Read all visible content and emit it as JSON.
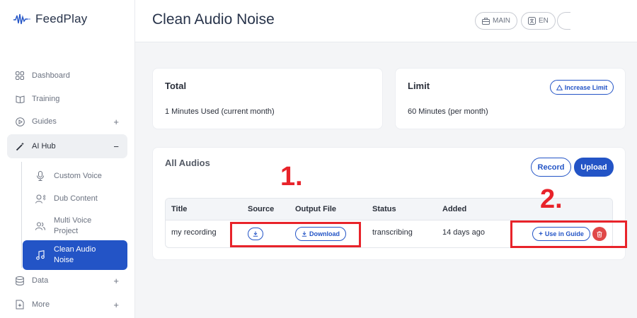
{
  "app": {
    "name": "FeedPlay"
  },
  "sidebar": {
    "items": [
      {
        "label": "Dashboard",
        "icon": "grid-icon"
      },
      {
        "label": "Training",
        "icon": "book-icon"
      },
      {
        "label": "Guides",
        "icon": "play-circle-icon",
        "toggle": "+"
      },
      {
        "label": "AI Hub",
        "icon": "magic-wand-icon",
        "toggle": "−"
      },
      {
        "label": "Data",
        "icon": "database-icon",
        "toggle": "+"
      },
      {
        "label": "More",
        "icon": "sparkle-doc-icon",
        "toggle": "+"
      }
    ],
    "sub_items": [
      {
        "label": "Custom Voice",
        "icon": "microphone-icon"
      },
      {
        "label": "Dub Content",
        "icon": "speaking-head-icon"
      },
      {
        "label": "Multi Voice Project",
        "icon": "users-icon"
      },
      {
        "label": "Clean Audio Noise",
        "icon": "music-note-icon",
        "active": true
      }
    ]
  },
  "header": {
    "title": "Clean Audio Noise",
    "pills": [
      {
        "label": "MAIN",
        "icon": "briefcase-icon"
      },
      {
        "label": "EN",
        "icon": "translate-icon"
      }
    ]
  },
  "total_card": {
    "title": "Total",
    "text": "1 Minutes Used (current month)"
  },
  "limit_card": {
    "title": "Limit",
    "text": "60 Minutes (per month)",
    "button": "Increase Limit"
  },
  "audios": {
    "title": "All Audios",
    "record_label": "Record",
    "upload_label": "Upload",
    "columns": [
      "Title",
      "Source",
      "Output File",
      "Status",
      "Added"
    ],
    "rows": [
      {
        "title": "my recording",
        "output": "Download",
        "status": "transcribing",
        "added": "14 days ago",
        "action": "Use in Guide"
      }
    ]
  },
  "annotations": {
    "one": "1.",
    "two": "2."
  },
  "colors": {
    "accent": "#2354c6",
    "danger": "#e04848",
    "annotation": "#e8232a"
  }
}
